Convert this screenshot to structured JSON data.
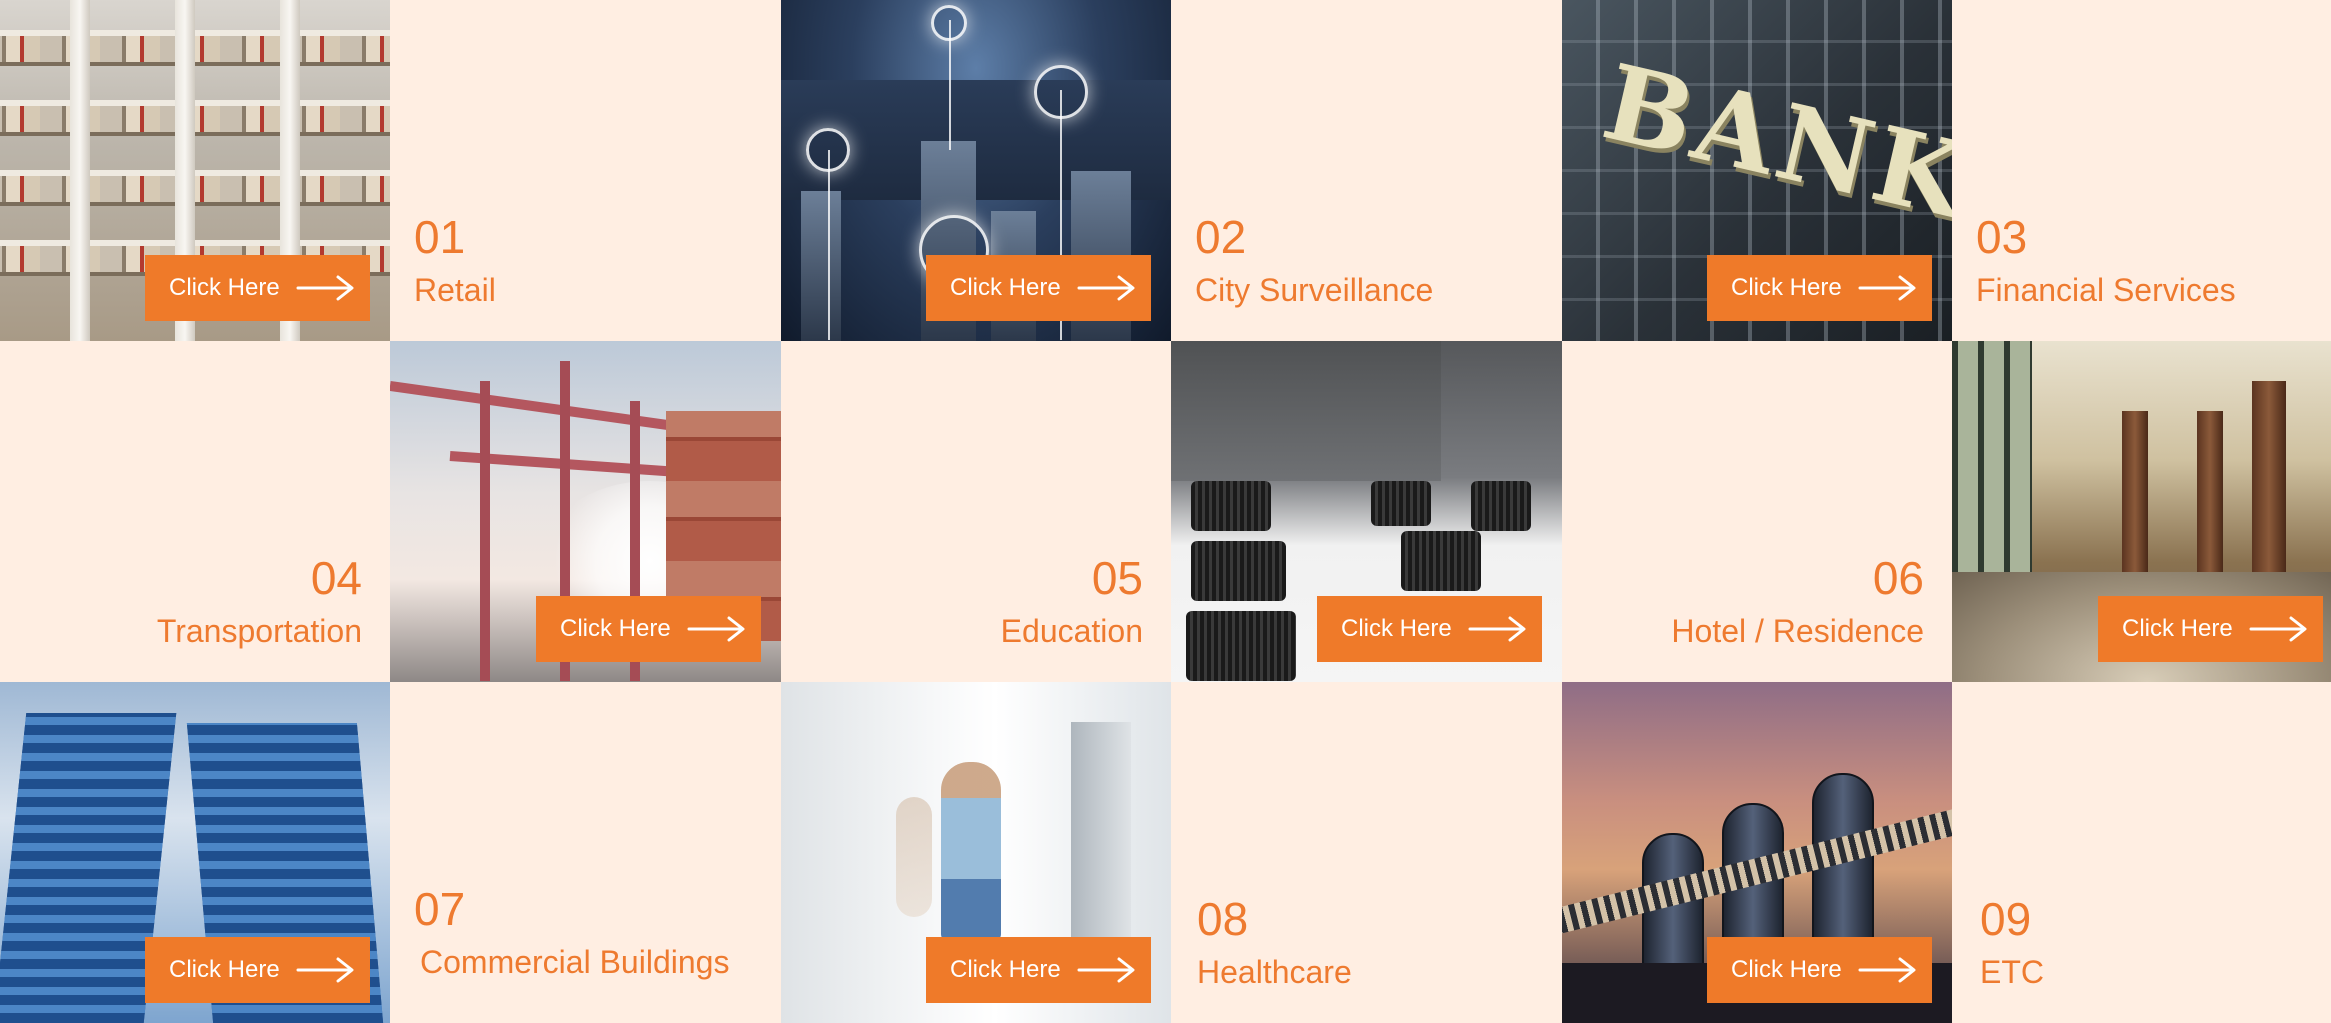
{
  "cta_label": "Click Here",
  "accent_color": "#ef7a29",
  "text_color": "#ee7a2f",
  "tile_background": "#ffeee2",
  "categories": [
    {
      "number": "01",
      "label": "Retail",
      "image": "shopping-mall-atrium"
    },
    {
      "number": "02",
      "label": "City Surveillance",
      "image": "city-skyline-security-shields"
    },
    {
      "number": "03",
      "label": "Financial Services",
      "image": "bank-building-sign"
    },
    {
      "number": "04",
      "label": "Transportation",
      "image": "container-port-cranes"
    },
    {
      "number": "05",
      "label": "Education",
      "image": "classroom-chairs"
    },
    {
      "number": "06",
      "label": "Hotel / Residence",
      "image": "hotel-lobby"
    },
    {
      "number": "07",
      "label": "Commercial Buildings",
      "image": "glass-office-towers"
    },
    {
      "number": "08",
      "label": "Healthcare",
      "image": "hospital-corridor"
    },
    {
      "number": "09",
      "label": "ETC",
      "image": "industrial-plant"
    }
  ]
}
